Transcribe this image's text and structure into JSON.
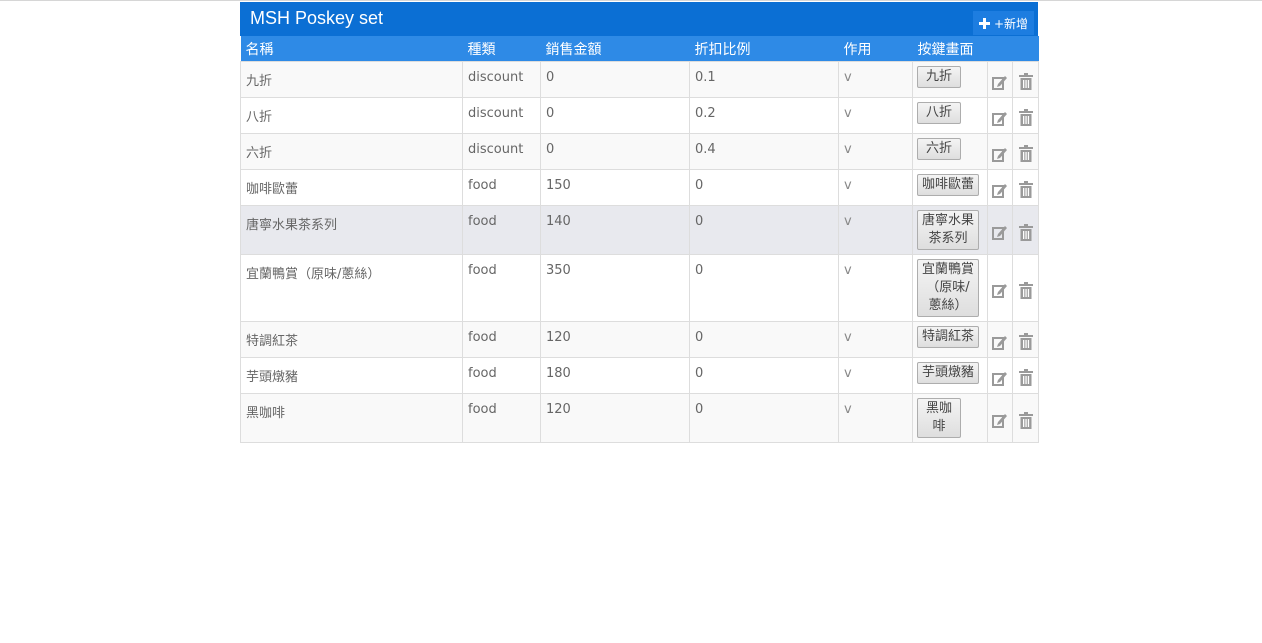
{
  "panel": {
    "title": "MSH Poskey set",
    "add_label": "+新增",
    "add_icon": "plus-icon"
  },
  "columns": [
    "名稱",
    "種類",
    "銷售金額",
    "折扣比例",
    "作用",
    "按鍵畫面"
  ],
  "rows": [
    {
      "name": "九折",
      "type": "discount",
      "price": "0",
      "ratio": "0.1",
      "active": "v",
      "key": "九折"
    },
    {
      "name": "八折",
      "type": "discount",
      "price": "0",
      "ratio": "0.2",
      "active": "v",
      "key": "八折"
    },
    {
      "name": "六折",
      "type": "discount",
      "price": "0",
      "ratio": "0.4",
      "active": "v",
      "key": "六折"
    },
    {
      "name": "咖啡歐蕾",
      "type": "food",
      "price": "150",
      "ratio": "0",
      "active": "v",
      "key": "咖啡歐蕾"
    },
    {
      "name": "唐寧水果茶系列",
      "type": "food",
      "price": "140",
      "ratio": "0",
      "active": "v",
      "key": "唐寧水果茶系列"
    },
    {
      "name": "宜蘭鴨賞（原味/蔥絲）",
      "type": "food",
      "price": "350",
      "ratio": "0",
      "active": "v",
      "key": "宜蘭鴨賞（原味/蔥絲）"
    },
    {
      "name": "特調紅茶",
      "type": "food",
      "price": "120",
      "ratio": "0",
      "active": "v",
      "key": "特調紅茶"
    },
    {
      "name": "芋頭燉豬",
      "type": "food",
      "price": "180",
      "ratio": "0",
      "active": "v",
      "key": "芋頭燉豬"
    },
    {
      "name": "黑咖啡",
      "type": "food",
      "price": "120",
      "ratio": "0",
      "active": "v",
      "key": "黑咖啡"
    }
  ],
  "icons": {
    "edit": "edit-icon",
    "delete": "trash-icon"
  },
  "colors": {
    "header": "#0b6fd4",
    "column_header": "#2e8ae6",
    "highlight_row": "#e8e9ee"
  }
}
